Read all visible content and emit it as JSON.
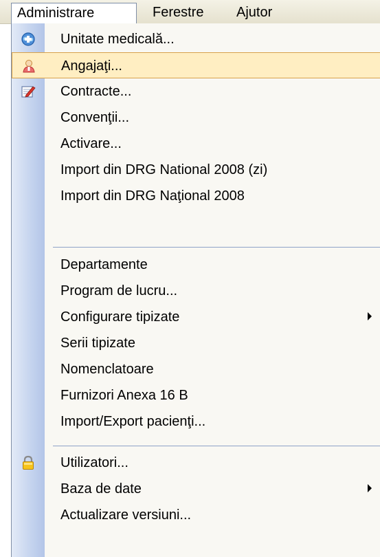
{
  "menubar": {
    "items": [
      {
        "label": "Administrare"
      },
      {
        "label": "Ferestre"
      },
      {
        "label": "Ajutor"
      }
    ]
  },
  "menu": {
    "group1": [
      {
        "label": "Unitate medicală...",
        "icon": "hospital-globe-icon"
      },
      {
        "label": "Angajaţi...",
        "icon": "employee-icon",
        "highlighted": true
      },
      {
        "label": "Contracte...",
        "icon": "contract-edit-icon"
      },
      {
        "label": "Convenţii..."
      },
      {
        "label": "Activare..."
      },
      {
        "label": "Import din DRG National 2008 (zi)"
      },
      {
        "label": "Import din DRG Naţional 2008"
      }
    ],
    "group2": [
      {
        "label": "Departamente"
      },
      {
        "label": "Program de lucru..."
      },
      {
        "label": "Configurare tipizate",
        "submenu": true
      },
      {
        "label": "Serii tipizate"
      },
      {
        "label": "Nomenclatoare"
      },
      {
        "label": "Furnizori Anexa 16 B"
      },
      {
        "label": "Import/Export pacienţi..."
      }
    ],
    "group3": [
      {
        "label": "Utilizatori...",
        "icon": "lock-icon"
      },
      {
        "label": "Baza de date",
        "submenu": true
      },
      {
        "label": "Actualizare versiuni..."
      }
    ]
  }
}
